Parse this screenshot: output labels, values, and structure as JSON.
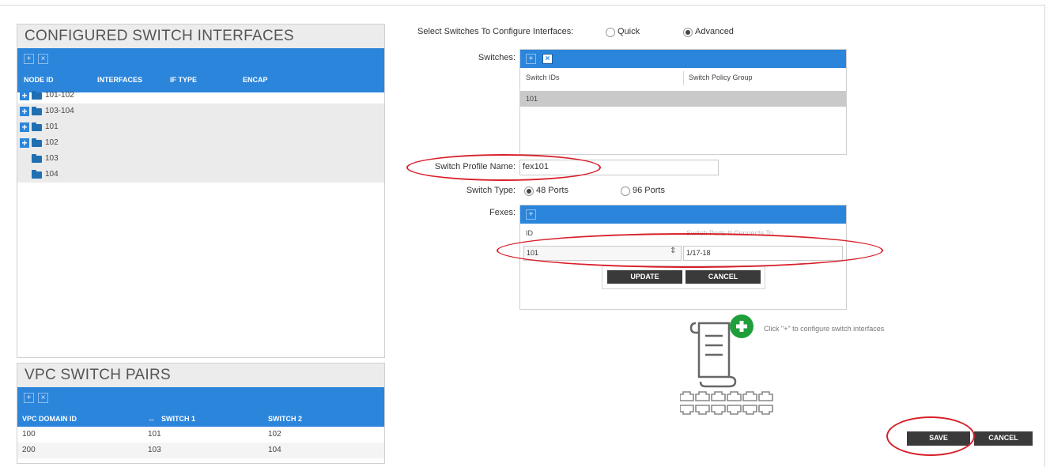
{
  "configured": {
    "title": "CONFIGURED SWITCH INTERFACES",
    "toolbar": {
      "add_icon": "plus-icon",
      "delete_icon": "x-icon"
    },
    "columns": [
      "NODE ID",
      "INTERFACES",
      "IF TYPE",
      "ENCAP"
    ],
    "nodes": [
      {
        "label": "101-102",
        "expandable": true
      },
      {
        "label": "103-104",
        "expandable": true
      },
      {
        "label": "101",
        "expandable": true
      },
      {
        "label": "102",
        "expandable": true
      },
      {
        "label": "103",
        "expandable": false
      },
      {
        "label": "104",
        "expandable": false
      }
    ]
  },
  "vpc": {
    "title": "VPC SWITCH PAIRS",
    "columns": [
      "VPC DOMAIN ID",
      "SWITCH 1",
      "SWITCH 2"
    ],
    "rows": [
      {
        "domain": "100",
        "switch1": "101",
        "switch2": "102"
      },
      {
        "domain": "200",
        "switch1": "103",
        "switch2": "104"
      }
    ]
  },
  "form": {
    "select_label": "Select Switches To Configure Interfaces:",
    "mode_quick": "Quick",
    "mode_advanced": "Advanced",
    "selected_mode": "Advanced",
    "switches_label": "Switches:",
    "switches_columns": [
      "Switch IDs",
      "Switch Policy Group"
    ],
    "switches_rows": [
      {
        "id": "101",
        "policy": ""
      }
    ],
    "profile_label": "Switch Profile Name:",
    "profile_value": "fex101",
    "type_label": "Switch Type:",
    "type_48": "48 Ports",
    "type_96": "96 Ports",
    "selected_type": "48 Ports",
    "fexes_label": "Fexes:",
    "fexes_columns": [
      "ID",
      "Switch Ports It Connects To"
    ],
    "fex_id": "101",
    "fex_ports": "1/17-18",
    "update_label": "UPDATE",
    "cancel_row_label": "CANCEL",
    "hint_text": "Click \"+\" to configure switch interfaces",
    "save_label": "SAVE",
    "cancel_label": "CANCEL"
  },
  "colors": {
    "accent": "#2b85db",
    "highlight_oval": "#d8202a",
    "button": "#3a3a3a",
    "plus_badge": "#1f9e3b"
  }
}
